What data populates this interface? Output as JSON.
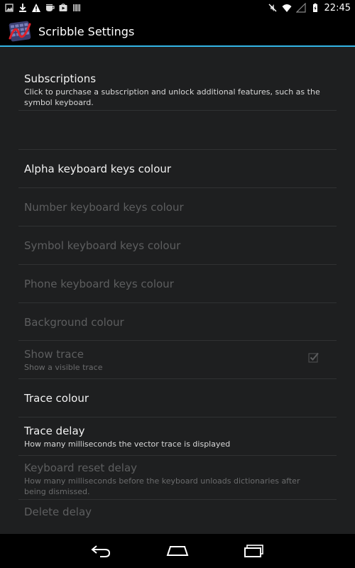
{
  "status_bar": {
    "time": "22:45",
    "left_icons": [
      "image-icon",
      "download-icon",
      "warning-icon",
      "cup-icon",
      "play-store-icon",
      "barcode-icon"
    ],
    "right_icons": [
      "mute-icon",
      "wifi-icon",
      "signal-icon",
      "battery-charging-icon"
    ]
  },
  "action_bar": {
    "title": "Scribble Settings",
    "accent_color": "#33b5e5"
  },
  "preferences": [
    {
      "id": "subscriptions",
      "title": "Subscriptions",
      "summary": "Click to purchase a subscription and unlock additional features, such as the symbol keyboard.",
      "enabled": true
    },
    {
      "id": "spacer",
      "title": "",
      "summary": "",
      "enabled": false
    },
    {
      "id": "alpha-keys-colour",
      "title": "Alpha keyboard keys colour",
      "summary": "",
      "enabled": true
    },
    {
      "id": "number-keys-colour",
      "title": "Number keyboard keys colour",
      "summary": "",
      "enabled": false
    },
    {
      "id": "symbol-keys-colour",
      "title": "Symbol keyboard keys colour",
      "summary": "",
      "enabled": false
    },
    {
      "id": "phone-keys-colour",
      "title": "Phone keyboard keys colour",
      "summary": "",
      "enabled": false
    },
    {
      "id": "background-colour",
      "title": "Background colour",
      "summary": "",
      "enabled": false
    },
    {
      "id": "show-trace",
      "title": "Show trace",
      "summary": "Show a visible trace",
      "enabled": false,
      "checked": true
    },
    {
      "id": "trace-colour",
      "title": "Trace colour",
      "summary": "",
      "enabled": true
    },
    {
      "id": "trace-delay",
      "title": "Trace delay",
      "summary": "How many milliseconds the vector trace is displayed",
      "enabled": true
    },
    {
      "id": "keyboard-reset-delay",
      "title": "Keyboard reset delay",
      "summary": "How many milliseconds before the keyboard unloads dictionaries after being dismissed.",
      "enabled": false
    },
    {
      "id": "delete-delay",
      "title": "Delete delay",
      "summary": "",
      "enabled": false
    }
  ],
  "nav_bar": {
    "buttons": [
      "back-icon",
      "home-icon",
      "recents-icon"
    ]
  }
}
